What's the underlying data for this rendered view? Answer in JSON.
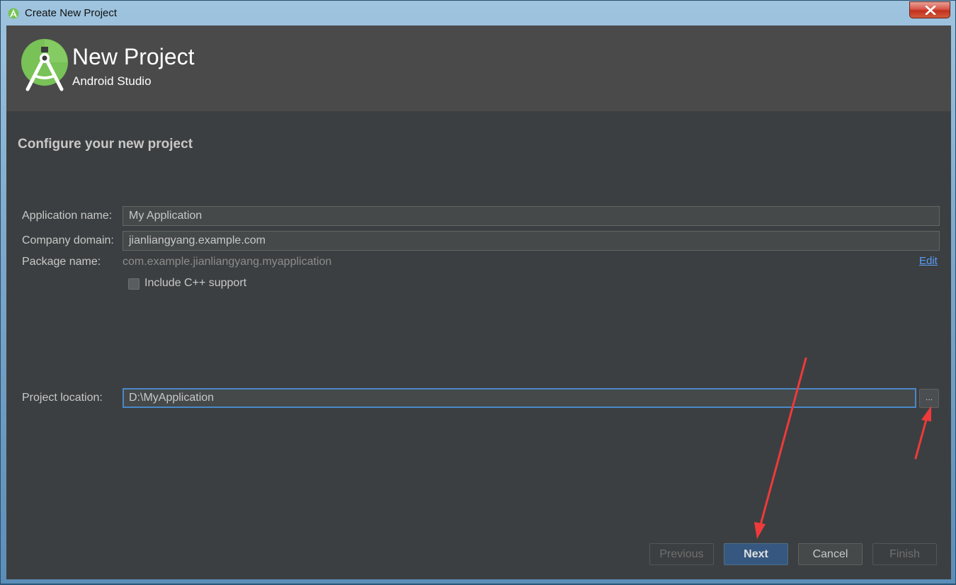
{
  "window": {
    "title": "Create New Project"
  },
  "header": {
    "title": "New Project",
    "subtitle": "Android Studio"
  },
  "section_title": "Configure your new project",
  "form": {
    "app_name_label": "Application name:",
    "app_name_value": "My Application",
    "company_domain_label": "Company domain:",
    "company_domain_value": "jianliangyang.example.com",
    "package_name_label": "Package name:",
    "package_name_value": "com.example.jianliangyang.myapplication",
    "edit_link": "Edit",
    "include_cpp_label": "Include C++ support",
    "include_cpp_checked": false,
    "project_location_label": "Project location:",
    "project_location_value": "D:\\MyApplication",
    "browse_label": "..."
  },
  "buttons": {
    "previous": "Previous",
    "next": "Next",
    "cancel": "Cancel",
    "finish": "Finish"
  },
  "colors": {
    "dialog_bg": "#3c3f41",
    "header_bg": "#4a4a4a",
    "primary_button": "#365880",
    "annotation_arrow": "#ee3a3a",
    "android_green": "#78c257"
  }
}
